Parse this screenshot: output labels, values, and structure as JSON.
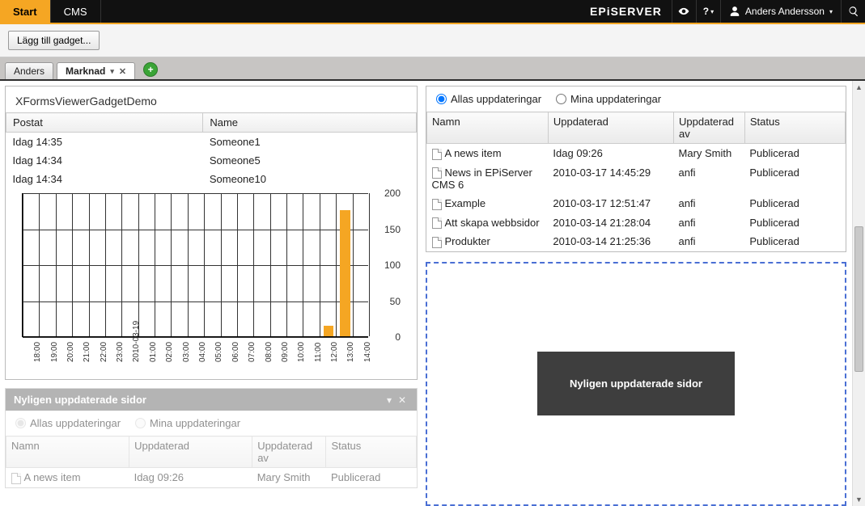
{
  "topbar": {
    "tabs": [
      {
        "label": "Start",
        "active": true
      },
      {
        "label": "CMS",
        "active": false
      }
    ],
    "brand": "EPiSERVER",
    "user": "Anders Andersson"
  },
  "toolbar": {
    "add_gadget_label": "Lägg till gadget..."
  },
  "tabstrip": {
    "tabs": [
      {
        "label": "Anders",
        "active": false,
        "closable": false
      },
      {
        "label": "Marknad",
        "active": true,
        "closable": true
      }
    ]
  },
  "xforms": {
    "title": "XFormsViewerGadgetDemo",
    "columns": {
      "postat": "Postat",
      "name": "Name"
    },
    "rows": [
      {
        "postat": "Idag 14:35",
        "name": "Someone1"
      },
      {
        "postat": "Idag 14:34",
        "name": "Someone5"
      },
      {
        "postat": "Idag 14:34",
        "name": "Someone10"
      }
    ]
  },
  "chart_data": {
    "type": "bar",
    "categories": [
      "18:00",
      "19:00",
      "20:00",
      "21:00",
      "22:00",
      "23:00",
      "2010-03-19",
      "01:00",
      "02:00",
      "03:00",
      "04:00",
      "05:00",
      "06:00",
      "07:00",
      "08:00",
      "09:00",
      "10:00",
      "11:00",
      "12:00",
      "13:00",
      "14:00"
    ],
    "values": [
      0,
      0,
      0,
      0,
      0,
      0,
      0,
      0,
      0,
      0,
      0,
      0,
      0,
      0,
      0,
      0,
      0,
      0,
      15,
      175,
      0
    ],
    "ylim": [
      0,
      200
    ],
    "yticks": [
      0,
      50,
      100,
      150,
      200
    ],
    "title": "",
    "xlabel": "",
    "ylabel": ""
  },
  "updates_panel": {
    "filter_all": "Allas uppdateringar",
    "filter_mine": "Mina uppdateringar",
    "selected_filter": "all",
    "columns": {
      "name": "Namn",
      "updated": "Uppdaterad",
      "by": "Uppdaterad av",
      "status": "Status"
    },
    "rows": [
      {
        "name": "A news item",
        "updated": "Idag 09:26",
        "by": "Mary Smith",
        "status": "Publicerad"
      },
      {
        "name": "News in EPiServer CMS 6",
        "updated": "2010-03-17 14:45:29",
        "by": "anfi",
        "status": "Publicerad"
      },
      {
        "name": "Example",
        "updated": "2010-03-17 12:51:47",
        "by": "anfi",
        "status": "Publicerad"
      },
      {
        "name": "Att skapa webbsidor",
        "updated": "2010-03-14 21:28:04",
        "by": "anfi",
        "status": "Publicerad"
      },
      {
        "name": "Produkter",
        "updated": "2010-03-14 21:25:36",
        "by": "anfi",
        "status": "Publicerad"
      }
    ]
  },
  "drag_ghost": {
    "label": "Nyligen uppdaterade sidor"
  },
  "bottom_gadget": {
    "title": "Nyligen uppdaterade sidor",
    "filter_all": "Allas uppdateringar",
    "filter_mine": "Mina uppdateringar",
    "columns": {
      "name": "Namn",
      "updated": "Uppdaterad",
      "by": "Uppdaterad av",
      "status": "Status"
    },
    "rows": [
      {
        "name": "A news item",
        "updated": "Idag 09:26",
        "by": "Mary Smith",
        "status": "Publicerad"
      }
    ]
  }
}
